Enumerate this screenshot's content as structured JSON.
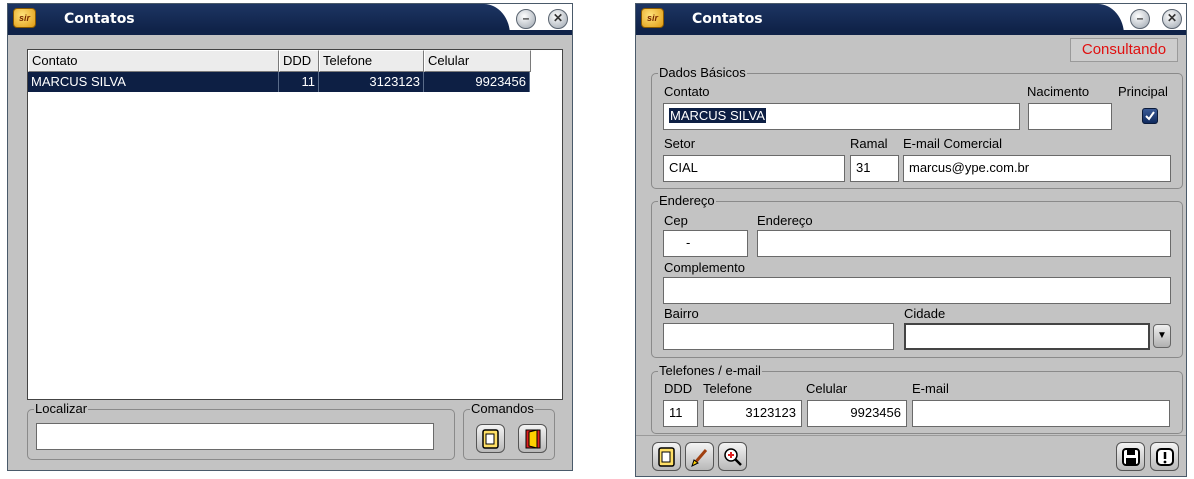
{
  "list_window": {
    "title": "Contatos",
    "app_icon_text": "sir",
    "columns": [
      "Contato",
      "DDD",
      "Telefone",
      "Celular"
    ],
    "rows": [
      {
        "contato": "MARCUS SILVA",
        "ddd": "11",
        "telefone": "3123123",
        "celular": "9923456"
      }
    ],
    "search_group": "Localizar",
    "search_value": "",
    "commands_group": "Comandos",
    "icons": [
      "new-document-icon",
      "exit-door-icon"
    ]
  },
  "detail_window": {
    "title": "Contatos",
    "app_icon_text": "sir",
    "status": "Consultando",
    "basic": {
      "legend": "Dados Básicos",
      "contato_label": "Contato",
      "contato_value": "MARCUS SILVA",
      "nascimento_label": "Nacimento",
      "nascimento_value": "",
      "principal_label": "Principal",
      "principal_checked": true,
      "setor_label": "Setor",
      "setor_value": "CIAL",
      "ramal_label": "Ramal",
      "ramal_value": "31",
      "email_label": "E-mail Comercial",
      "email_value": "marcus@ype.com.br"
    },
    "address": {
      "legend": "Endereço",
      "cep_label": "Cep",
      "cep_value": "-",
      "endereco_label": "Endereço",
      "endereco_value": "",
      "complemento_label": "Complemento",
      "complemento_value": "",
      "bairro_label": "Bairro",
      "bairro_value": "",
      "cidade_label": "Cidade",
      "cidade_value": ""
    },
    "phones": {
      "legend": "Telefones / e-mail",
      "ddd_label": "DDD",
      "ddd_value": "11",
      "telefone_label": "Telefone",
      "telefone_value": "3123123",
      "celular_label": "Celular",
      "celular_value": "9923456",
      "email_label": "E-mail",
      "email_value": ""
    },
    "icons": [
      "new-document-icon",
      "edit-brush-icon",
      "search-zoom-icon",
      "save-disk-icon",
      "alert-icon"
    ]
  },
  "colors": {
    "titlebar": "#0d1f44",
    "window_bg": "#c3c3c3",
    "selection": "#0d1f44",
    "status_text": "#e01010"
  }
}
